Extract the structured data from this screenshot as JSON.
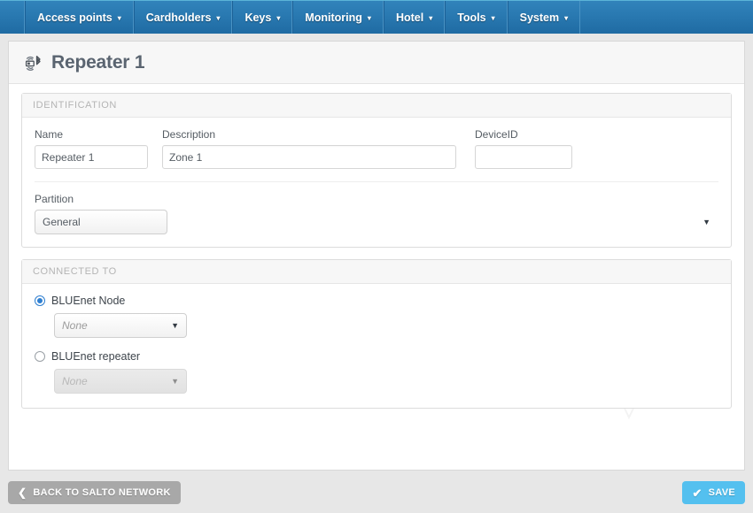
{
  "nav": {
    "items": [
      {
        "label": "Access points",
        "caret": "▾"
      },
      {
        "label": "Cardholders",
        "caret": "▾"
      },
      {
        "label": "Keys",
        "caret": "▾"
      },
      {
        "label": "Monitoring",
        "caret": "▾"
      },
      {
        "label": "Hotel",
        "caret": "▾"
      },
      {
        "label": "Tools",
        "caret": "▾"
      },
      {
        "label": "System",
        "caret": "▾"
      }
    ]
  },
  "page": {
    "title": "Repeater 1",
    "title_icon": "repeater-bluetooth-icon"
  },
  "identification": {
    "heading": "IDENTIFICATION",
    "name": {
      "label": "Name",
      "value": "Repeater 1",
      "placeholder": ""
    },
    "description": {
      "label": "Description",
      "value": "Zone 1",
      "placeholder": ""
    },
    "device_id": {
      "label": "DeviceID",
      "value": "",
      "placeholder": ""
    },
    "partition": {
      "label": "Partition",
      "value": "General",
      "options": [
        "General"
      ]
    }
  },
  "connected_to": {
    "heading": "CONNECTED TO",
    "node": {
      "label": "BLUEnet Node",
      "selected": true,
      "select_value": "None",
      "options": [
        "None"
      ]
    },
    "repeater": {
      "label": "BLUEnet repeater",
      "selected": false,
      "select_value": "None",
      "options": [
        "None"
      ],
      "disabled": true
    }
  },
  "footer": {
    "back_label": "BACK TO SALTO NETWORK",
    "back_icon": "chevron-left-icon",
    "save_label": "SAVE",
    "save_icon": "check-icon"
  },
  "colors": {
    "navbar": "#2a7ab2",
    "save_button": "#54c0ef",
    "back_button": "#a8a8a8",
    "radio_accent": "#2f7fd0",
    "page_background": "#e7e7e7"
  }
}
